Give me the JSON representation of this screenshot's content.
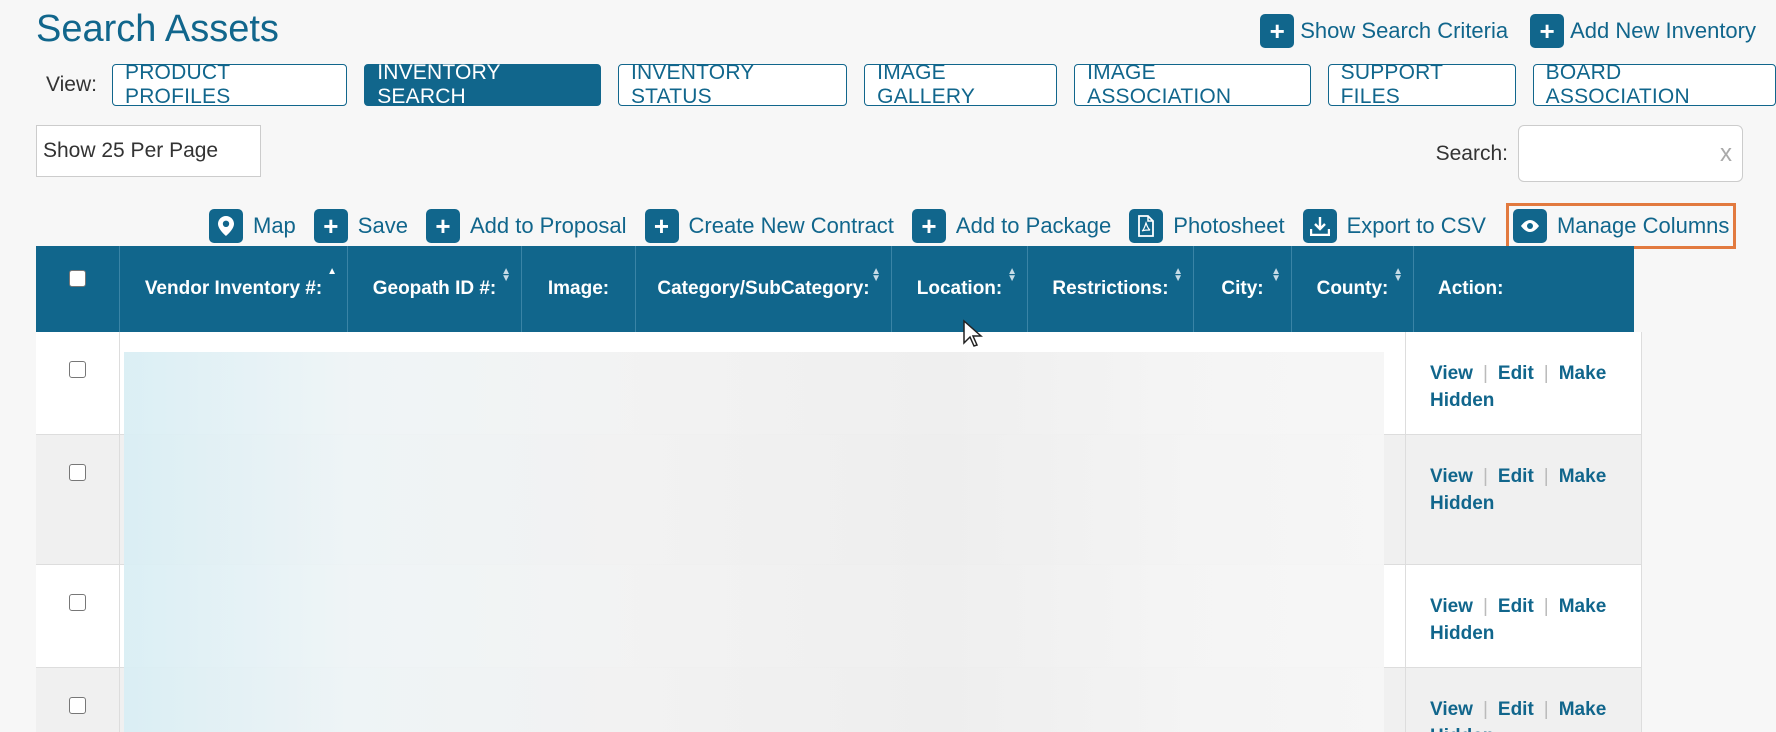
{
  "page_title": "Search Assets",
  "top_actions": [
    {
      "label": "Show Search Criteria",
      "icon": "plus-icon"
    },
    {
      "label": "Add New Inventory",
      "icon": "plus-icon"
    }
  ],
  "view": {
    "label": "View:",
    "tabs": [
      {
        "label": "PRODUCT PROFILES",
        "active": false
      },
      {
        "label": "INVENTORY SEARCH",
        "active": true
      },
      {
        "label": "INVENTORY STATUS",
        "active": false
      },
      {
        "label": "IMAGE GALLERY",
        "active": false
      },
      {
        "label": "IMAGE ASSOCIATION",
        "active": false
      },
      {
        "label": "SUPPORT FILES",
        "active": false
      },
      {
        "label": "BOARD ASSOCIATION",
        "active": false
      }
    ]
  },
  "per_page": {
    "value": "Show 25 Per Page"
  },
  "search": {
    "label": "Search:",
    "value": "",
    "clear": "x"
  },
  "toolbar": {
    "items": [
      {
        "label": "Map",
        "icon": "map-pin-icon"
      },
      {
        "label": "Save",
        "icon": "plus-icon"
      },
      {
        "label": "Add to Proposal",
        "icon": "plus-icon"
      },
      {
        "label": "Create New Contract",
        "icon": "plus-icon"
      },
      {
        "label": "Add to Package",
        "icon": "plus-icon"
      },
      {
        "label": "Photosheet",
        "icon": "pdf-icon"
      },
      {
        "label": "Export to CSV",
        "icon": "download-icon"
      },
      {
        "label": "Manage Columns",
        "icon": "eye-icon"
      }
    ]
  },
  "table": {
    "columns": [
      {
        "label": "Vendor Inventory #:"
      },
      {
        "label": "Geopath ID #:"
      },
      {
        "label": "Image:"
      },
      {
        "label": "Category/SubCategory:"
      },
      {
        "label": "Location:"
      },
      {
        "label": "Restrictions:"
      },
      {
        "label": "City:"
      },
      {
        "label": "County:"
      },
      {
        "label": "Action:"
      }
    ],
    "row_actions": {
      "view": "View",
      "edit": "Edit",
      "make_hidden": "Make Hidden"
    }
  },
  "colors": {
    "primary": "#11668c",
    "highlight": "#e27a3f"
  }
}
